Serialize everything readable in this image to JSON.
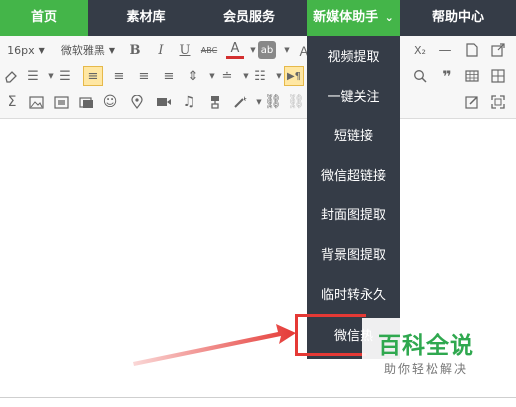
{
  "nav": {
    "items": [
      "首页",
      "素材库",
      "会员服务",
      "新媒体助手",
      "帮助中心"
    ],
    "active_arrow": "⌄"
  },
  "toolbar": {
    "font_size": "16px",
    "font_family": "微软雅黑",
    "bold": "B",
    "italic": "I",
    "underline": "U",
    "strike": "ABC",
    "font_color": "A",
    "highlight": "ab",
    "subscript": "X₂"
  },
  "dropdown": {
    "items": [
      "视频提取",
      "一键关注",
      "短链接",
      "微信超链接",
      "封面图提取",
      "背景图提取",
      "临时转永久",
      "微信热"
    ]
  },
  "watermark": {
    "title": "百科全说",
    "subtitle": "助你轻松解决"
  },
  "colors": {
    "nav_bg": "#353c47",
    "nav_active": "#44b549",
    "highlight": "#e53935",
    "watermark": "#2fa84f"
  }
}
